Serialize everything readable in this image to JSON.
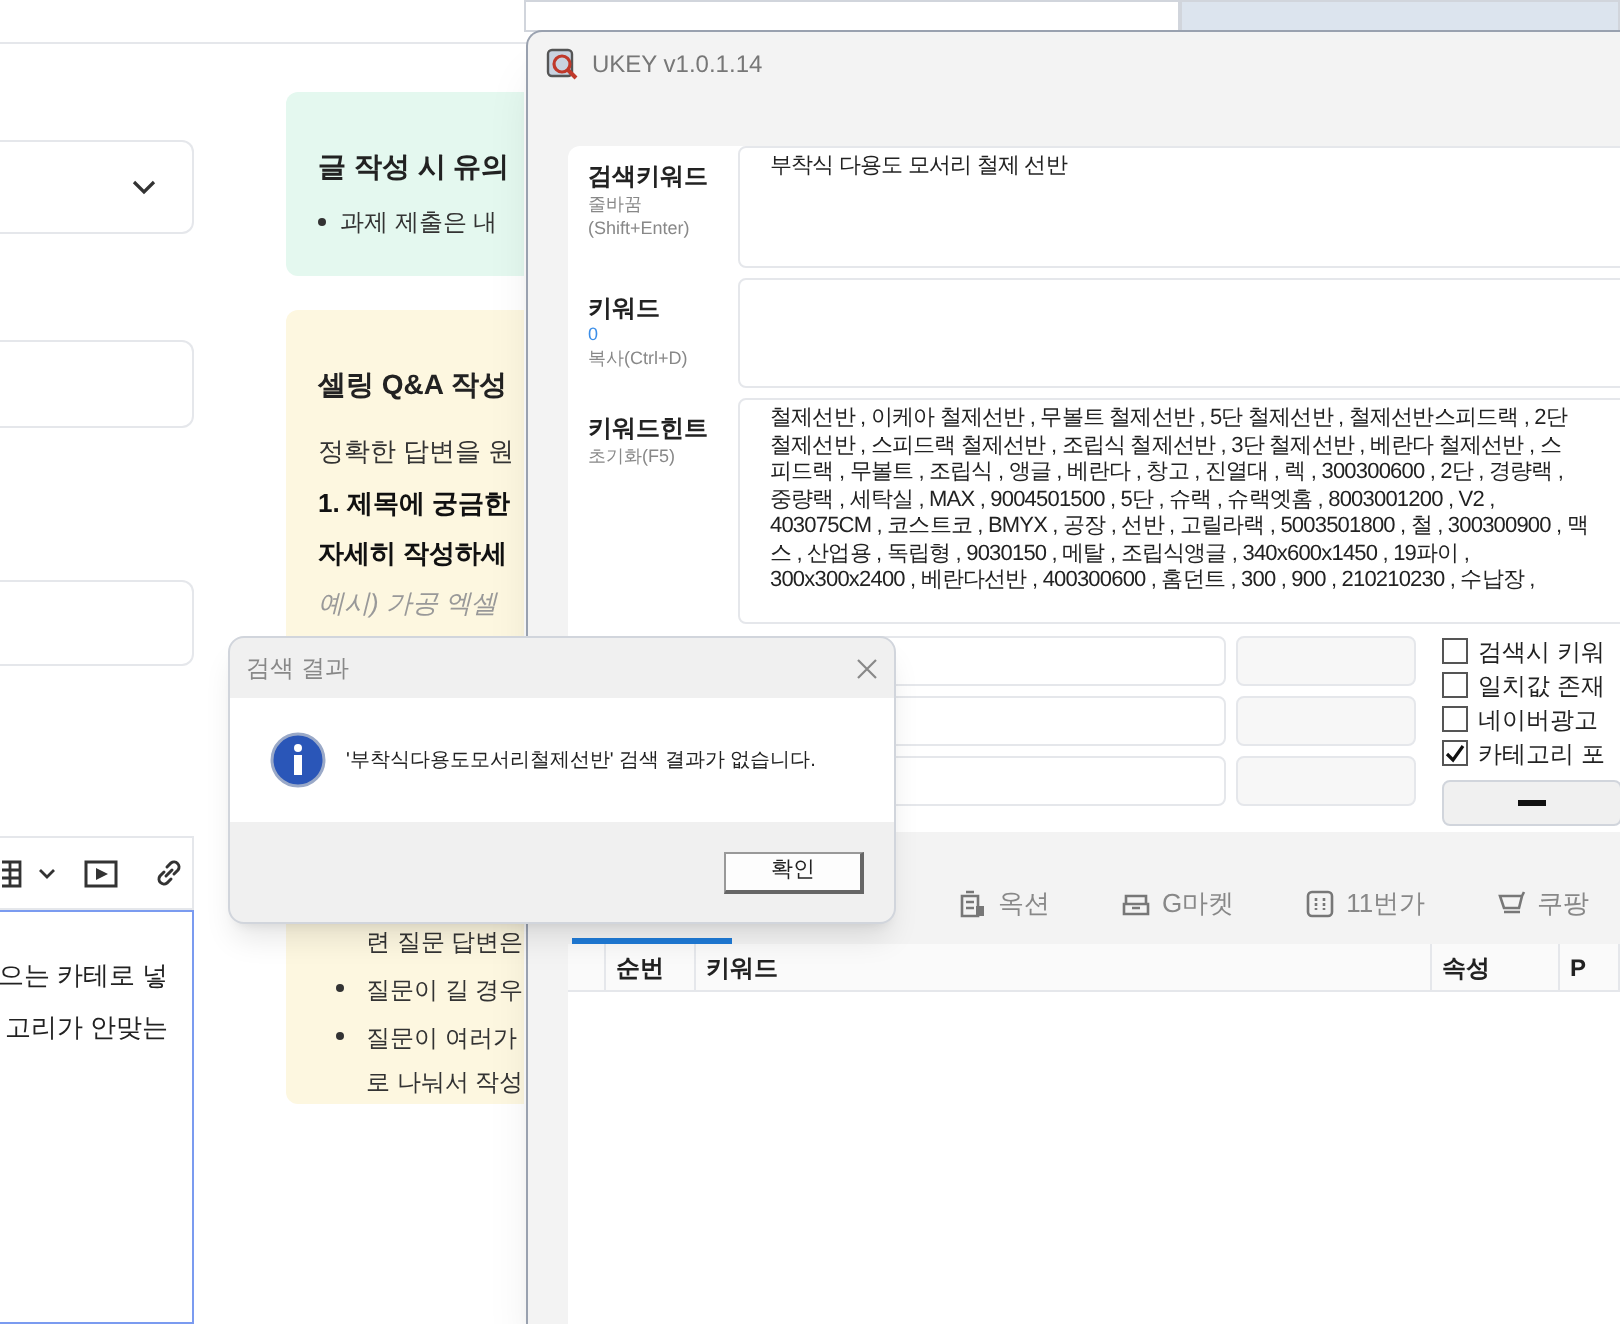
{
  "web_page": {
    "notice_card": {
      "title": "글 작성 시 유의",
      "bullets": [
        "과제 제출은 내"
      ]
    },
    "qa_card": {
      "title": "셀링 Q&A 작성",
      "intro": "정확한 답변을 원",
      "bold_lines": [
        "1. 제목에 궁금한",
        "자세히 작성하세"
      ],
      "example": "예시) 가공 엑셀",
      "continuation": "련 질문 답변은",
      "bullets": [
        {
          "lines": [
            "질문이 길 경우"
          ]
        },
        {
          "lines": [
            "질문이 여러가",
            "로 나눠서 작성"
          ]
        }
      ]
    },
    "editor_lines": [
      "으는 카테로 넣",
      "고리가 안맞는"
    ]
  },
  "ukey": {
    "title": "UKEY v1.0.1.14",
    "fields": [
      {
        "label": "검색키워드",
        "sublabels": [
          "줄바꿈",
          "(Shift+Enter)"
        ],
        "lines": [
          "부착식 다용도 모서리 철제 선반"
        ]
      },
      {
        "label": "키워드",
        "count": "0",
        "sublabels": [
          "복사(Ctrl+D)"
        ]
      },
      {
        "label": "키워드힌트",
        "sublabels": [
          "초기화(F5)"
        ],
        "lines": [
          "철제선반 , 이케아 철제선반 , 무볼트 철제선반 , 5단 철제선반 , 철제선반스피드랙 , 2단",
          "철제선반 , 스피드랙 철제선반 , 조립식 철제선반 , 3단 철제선반 , 베란다 철제선반 , 스",
          "피드랙 , 무볼트 , 조립식 , 앵글 , 베란다 , 창고 , 진열대 , 렉 , 300300600 , 2단 , 경량랙 ,",
          "중량랙 , 세탁실 , MAX , 9004501500 , 5단 , 슈랙 , 슈랙엣홈 , 8003001200 , V2 ,",
          "403075CM , 코스트코 , BMYX , 공장 , 선반 , 고릴라랙 , 5003501800 , 철 , 300300900 , 맥",
          "스 , 산업용 , 독립형 , 9030150 , 메탈 , 조립식앵글 , 340x600x1450 , 19파이 ,",
          "300x300x2400 , 베란다선반 , 400300600 , 홈던트 , 300 , 900 , 210210230 , 수납장 ,"
        ]
      }
    ],
    "options": [
      {
        "label": "검색시 키워",
        "checked": false
      },
      {
        "label": "일치값 존재",
        "checked": false
      },
      {
        "label": "네이버광고",
        "checked": false
      },
      {
        "label": "카테고리 포",
        "checked": true
      }
    ],
    "tabs": [
      {
        "label": "옥션",
        "selected": false
      },
      {
        "label": "G마켓",
        "selected": false
      },
      {
        "label": "11번가",
        "selected": false
      },
      {
        "label": "쿠팡",
        "selected": false
      }
    ],
    "table": {
      "columns": [
        "순번",
        "키워드",
        "속성",
        "P"
      ]
    }
  },
  "dialog": {
    "title": "검색 결과",
    "message": "'부착식다용도모서리철제선반' 검색 결과가 없습니다.",
    "button": "확인"
  }
}
